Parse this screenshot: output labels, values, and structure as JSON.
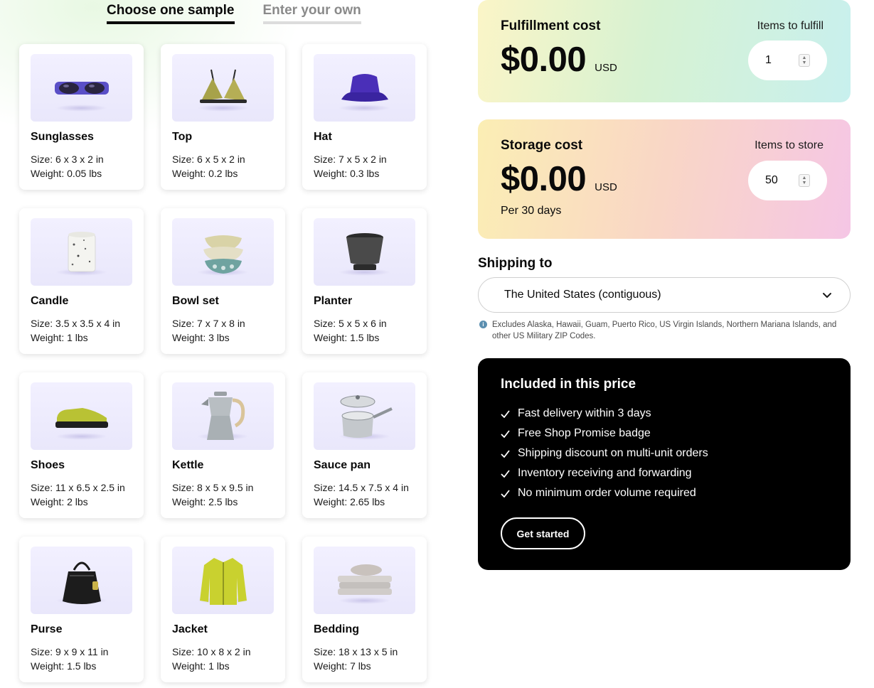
{
  "tabs": [
    {
      "label": "Choose one sample",
      "active": true
    },
    {
      "label": "Enter your own",
      "active": false
    }
  ],
  "products": [
    {
      "name": "Sunglasses",
      "size": "Size: 6 x 3 x 2 in",
      "weight": "Weight: 0.05 lbs",
      "icon": "sunglasses-icon"
    },
    {
      "name": "Top",
      "size": "Size: 6 x 5 x 2 in",
      "weight": "Weight: 0.2 lbs",
      "icon": "bikini-top-icon"
    },
    {
      "name": "Hat",
      "size": "Size: 7 x 5 x 2 in",
      "weight": "Weight: 0.3 lbs",
      "icon": "bucket-hat-icon"
    },
    {
      "name": "Candle",
      "size": "Size: 3.5 x 3.5 x 4 in",
      "weight": "Weight: 1 lbs",
      "icon": "candle-icon"
    },
    {
      "name": "Bowl set",
      "size": "Size: 7 x 7 x 8 in",
      "weight": "Weight: 3 lbs",
      "icon": "bowl-set-icon"
    },
    {
      "name": "Planter",
      "size": "Size: 5 x 5 x 6 in",
      "weight": "Weight: 1.5 lbs",
      "icon": "planter-icon"
    },
    {
      "name": "Shoes",
      "size": "Size: 11 x 6.5 x 2.5 in",
      "weight": "Weight: 2 lbs",
      "icon": "shoe-icon"
    },
    {
      "name": "Kettle",
      "size": "Size: 8 x 5 x 9.5 in",
      "weight": "Weight: 2.5 lbs",
      "icon": "kettle-icon"
    },
    {
      "name": "Sauce pan",
      "size": "Size: 14.5 x 7.5 x 4 in",
      "weight": "Weight: 2.65 lbs",
      "icon": "sauce-pan-icon"
    },
    {
      "name": "Purse",
      "size": "Size: 9 x 9 x 11 in",
      "weight": "Weight: 1.5 lbs",
      "icon": "purse-icon"
    },
    {
      "name": "Jacket",
      "size": "Size: 10 x 8 x 2 in",
      "weight": "Weight: 1 lbs",
      "icon": "jacket-icon"
    },
    {
      "name": "Bedding",
      "size": "Size: 18 x 13 x 5 in",
      "weight": "Weight: 7 lbs",
      "icon": "bedding-icon"
    }
  ],
  "fulfillment": {
    "title": "Fulfillment cost",
    "amount": "$0.00",
    "currency": "USD",
    "qty_label": "Items to fulfill",
    "qty_value": "1"
  },
  "storage": {
    "title": "Storage cost",
    "amount": "$0.00",
    "currency": "USD",
    "period": "Per 30 days",
    "qty_label": "Items to store",
    "qty_value": "50"
  },
  "shipping": {
    "label": "Shipping to",
    "selected": "The United States (contiguous)",
    "note": "Excludes Alaska, Hawaii, Guam, Puerto Rico, US Virgin Islands, Northern Mariana Islands, and other US Military ZIP Codes."
  },
  "included": {
    "title": "Included in this price",
    "items": [
      "Fast delivery within 3 days",
      "Free Shop Promise badge",
      "Shipping discount on multi-unit orders",
      "Inventory receiving and forwarding",
      "No minimum order volume required"
    ],
    "cta": "Get started"
  },
  "colors": {
    "accent_black": "#000000",
    "thumb_bg": "#efedfd",
    "fulfill_gradient": [
      "#fbf5c7",
      "#d7f2d2",
      "#c8f0ee"
    ],
    "storage_gradient": [
      "#fbeeb4",
      "#f9d6c6",
      "#f5c6e5"
    ]
  }
}
